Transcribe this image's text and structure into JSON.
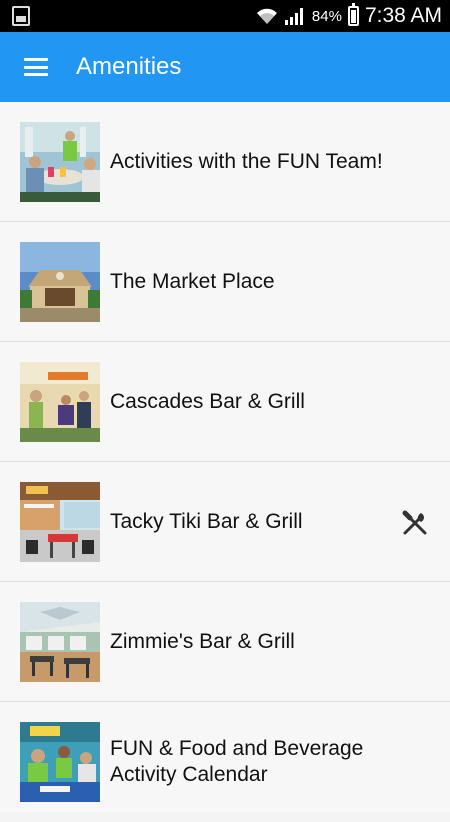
{
  "status_bar": {
    "battery_percent": "84%",
    "time": "7:38 AM",
    "battery_level": 0.84
  },
  "app_bar": {
    "title": "Amenities",
    "color": "#2196f3"
  },
  "items": [
    {
      "label": "Activities with the FUN Team!",
      "icon": null
    },
    {
      "label": "The Market Place",
      "icon": null
    },
    {
      "label": "Cascades Bar & Grill",
      "icon": null
    },
    {
      "label": "Tacky Tiki Bar & Grill",
      "icon": "fork-knife-icon"
    },
    {
      "label": "Zimmie's Bar & Grill",
      "icon": null
    },
    {
      "label": "FUN & Food and Beverage Activity Calendar",
      "icon": null
    }
  ]
}
